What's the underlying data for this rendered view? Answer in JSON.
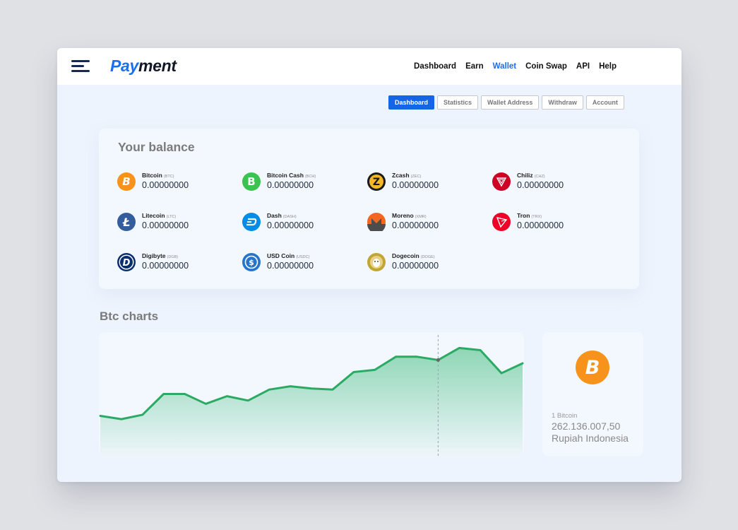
{
  "app": {
    "logo_part1": "Pay",
    "logo_part2": "ment"
  },
  "nav": [
    {
      "label": "Dashboard",
      "active": false
    },
    {
      "label": "Earn",
      "active": false
    },
    {
      "label": "Wallet",
      "active": true
    },
    {
      "label": "Coin Swap",
      "active": false
    },
    {
      "label": "API",
      "active": false
    },
    {
      "label": "Help",
      "active": false
    }
  ],
  "tabs": [
    {
      "label": "Dashboard",
      "active": true
    },
    {
      "label": "Statistics",
      "active": false
    },
    {
      "label": "Wallet Address",
      "active": false
    },
    {
      "label": "Withdraw",
      "active": false
    },
    {
      "label": "Account",
      "active": false
    }
  ],
  "balance": {
    "title": "Your balance",
    "coins": [
      {
        "name": "Bitcoin",
        "ticker": "(BTC)",
        "amount": "0.00000000",
        "icon": "bitcoin-icon",
        "color": "#f7931a"
      },
      {
        "name": "Bitcoin Cash",
        "ticker": "(BCH)",
        "amount": "0.00000000",
        "icon": "bitcoin-cash-icon",
        "color": "#3cc34f"
      },
      {
        "name": "Zcash",
        "ticker": "(ZEC)",
        "amount": "0.00000000",
        "icon": "zcash-icon",
        "color": "#f4b728"
      },
      {
        "name": "Chiliz",
        "ticker": "(CHZ)",
        "amount": "0.00000000",
        "icon": "chiliz-icon",
        "color": "#cd0124"
      },
      {
        "name": "Litecoin",
        "ticker": "(LTC)",
        "amount": "0.00000000",
        "icon": "litecoin-icon",
        "color": "#345d9d"
      },
      {
        "name": "Dash",
        "ticker": "(DASH)",
        "amount": "0.00000000",
        "icon": "dash-icon",
        "color": "#008ce7"
      },
      {
        "name": "Moreno",
        "ticker": "(XMR)",
        "amount": "0.00000000",
        "icon": "monero-icon",
        "color": "#f26822"
      },
      {
        "name": "Tron",
        "ticker": "(TRX)",
        "amount": "0.00000000",
        "icon": "tron-icon",
        "color": "#ef0027"
      },
      {
        "name": "Digibyte",
        "ticker": "(DGB)",
        "amount": "0.00000000",
        "icon": "digibyte-icon",
        "color": "#0a2d6e"
      },
      {
        "name": "USD Coin",
        "ticker": "(USDC)",
        "amount": "0.00000000",
        "icon": "usd-coin-icon",
        "color": "#2775ca"
      },
      {
        "name": "Dogecoin",
        "ticker": "(DOGE)",
        "amount": "0.00000000",
        "icon": "dogecoin-icon",
        "color": "#c2a633"
      }
    ]
  },
  "charts": {
    "title": "Btc charts"
  },
  "price": {
    "unit": "1 Bitcoin",
    "value": "262.136.007,50",
    "currency": "Rupiah Indonesia",
    "icon": "bitcoin-icon"
  },
  "chart_data": {
    "type": "area",
    "title": "Btc charts",
    "x": [
      0,
      1,
      2,
      3,
      4,
      5,
      6,
      7,
      8,
      9,
      10,
      11,
      12,
      13,
      14,
      15,
      16,
      17,
      18,
      19,
      20
    ],
    "values": [
      30,
      27,
      31,
      50,
      50,
      41,
      48,
      44,
      54,
      57,
      55,
      54,
      70,
      72,
      84,
      84,
      81,
      92,
      90,
      69,
      78
    ],
    "color": "#2baa64",
    "ylim": [
      0,
      100
    ],
    "grid": false,
    "highlight_index": 16
  }
}
